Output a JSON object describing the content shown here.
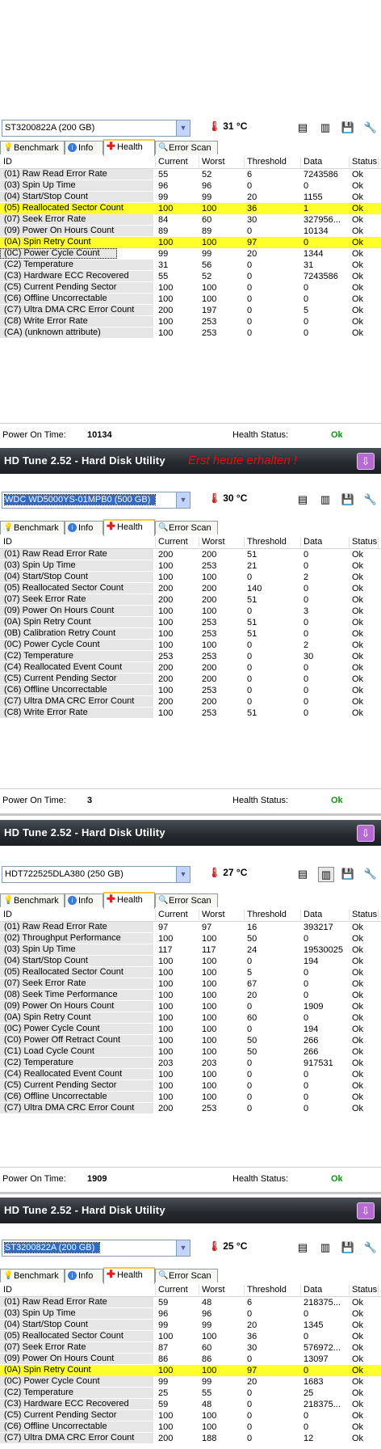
{
  "colors": {
    "highlight": "#ffff2a",
    "title_bg": "#262b31",
    "ok": "#0a9a0a",
    "note": "#e01010"
  },
  "tabs": [
    "Benchmark",
    "Info",
    "Health",
    "Error Scan"
  ],
  "columns": [
    "ID",
    "Current",
    "Worst",
    "Threshold",
    "Data",
    "Status"
  ],
  "labels": {
    "power_on": "Power On Time:",
    "health": "Health Status:"
  },
  "temp_icon": "thermometer-icon",
  "toolbar_icons": [
    "copy-icon",
    "copy-info-icon",
    "save-icon",
    "options-icon"
  ],
  "panels": [
    {
      "title": "",
      "note": "",
      "drive": "ST3200822A (200 GB)",
      "drive_selected": false,
      "temp": "31 °C",
      "power_on": "10134",
      "health": "Ok",
      "rows": [
        {
          "id": "(01) Raw Read Error Rate",
          "current": "55",
          "worst": "52",
          "threshold": "6",
          "data": "7243586",
          "status": "Ok"
        },
        {
          "id": "(03) Spin Up Time",
          "current": "96",
          "worst": "96",
          "threshold": "0",
          "data": "0",
          "status": "Ok"
        },
        {
          "id": "(04) Start/Stop Count",
          "current": "99",
          "worst": "99",
          "threshold": "20",
          "data": "1155",
          "status": "Ok"
        },
        {
          "id": "(05) Reallocated Sector Count",
          "current": "100",
          "worst": "100",
          "threshold": "36",
          "data": "1",
          "status": "Ok",
          "hl": true
        },
        {
          "id": "(07) Seek Error Rate",
          "current": "84",
          "worst": "60",
          "threshold": "30",
          "data": "327956...",
          "status": "Ok"
        },
        {
          "id": "(09) Power On Hours Count",
          "current": "89",
          "worst": "89",
          "threshold": "0",
          "data": "10134",
          "status": "Ok"
        },
        {
          "id": "(0A) Spin Retry Count",
          "current": "100",
          "worst": "100",
          "threshold": "97",
          "data": "0",
          "status": "Ok",
          "hl": true
        },
        {
          "id": "(0C) Power Cycle Count",
          "current": "99",
          "worst": "99",
          "threshold": "20",
          "data": "1344",
          "status": "Ok",
          "focus": true
        },
        {
          "id": "(C2) Temperature",
          "current": "31",
          "worst": "56",
          "threshold": "0",
          "data": "31",
          "status": "Ok"
        },
        {
          "id": "(C3) Hardware ECC Recovered",
          "current": "55",
          "worst": "52",
          "threshold": "0",
          "data": "7243586",
          "status": "Ok"
        },
        {
          "id": "(C5) Current Pending Sector",
          "current": "100",
          "worst": "100",
          "threshold": "0",
          "data": "0",
          "status": "Ok"
        },
        {
          "id": "(C6) Offline Uncorrectable",
          "current": "100",
          "worst": "100",
          "threshold": "0",
          "data": "0",
          "status": "Ok"
        },
        {
          "id": "(C7) Ultra DMA CRC Error Count",
          "current": "200",
          "worst": "197",
          "threshold": "0",
          "data": "5",
          "status": "Ok"
        },
        {
          "id": "(C8) Write Error Rate",
          "current": "100",
          "worst": "253",
          "threshold": "0",
          "data": "0",
          "status": "Ok"
        },
        {
          "id": "(CA) (unknown attribute)",
          "current": "100",
          "worst": "253",
          "threshold": "0",
          "data": "0",
          "status": "Ok"
        }
      ]
    },
    {
      "title": "HD Tune 2.52 - Hard Disk Utility",
      "note": "Erst heute erhalten !",
      "drive": "WDC WD5000YS-01MPB0 (500 GB)",
      "drive_selected": true,
      "temp": "30 °C",
      "power_on": "3",
      "health": "Ok",
      "rows": [
        {
          "id": "(01) Raw Read Error Rate",
          "current": "200",
          "worst": "200",
          "threshold": "51",
          "data": "0",
          "status": "Ok"
        },
        {
          "id": "(03) Spin Up Time",
          "current": "100",
          "worst": "253",
          "threshold": "21",
          "data": "0",
          "status": "Ok"
        },
        {
          "id": "(04) Start/Stop Count",
          "current": "100",
          "worst": "100",
          "threshold": "0",
          "data": "2",
          "status": "Ok"
        },
        {
          "id": "(05) Reallocated Sector Count",
          "current": "200",
          "worst": "200",
          "threshold": "140",
          "data": "0",
          "status": "Ok"
        },
        {
          "id": "(07) Seek Error Rate",
          "current": "200",
          "worst": "200",
          "threshold": "51",
          "data": "0",
          "status": "Ok"
        },
        {
          "id": "(09) Power On Hours Count",
          "current": "100",
          "worst": "100",
          "threshold": "0",
          "data": "3",
          "status": "Ok"
        },
        {
          "id": "(0A) Spin Retry Count",
          "current": "100",
          "worst": "253",
          "threshold": "51",
          "data": "0",
          "status": "Ok"
        },
        {
          "id": "(0B) Calibration Retry Count",
          "current": "100",
          "worst": "253",
          "threshold": "51",
          "data": "0",
          "status": "Ok"
        },
        {
          "id": "(0C) Power Cycle Count",
          "current": "100",
          "worst": "100",
          "threshold": "0",
          "data": "2",
          "status": "Ok"
        },
        {
          "id": "(C2) Temperature",
          "current": "253",
          "worst": "253",
          "threshold": "0",
          "data": "30",
          "status": "Ok"
        },
        {
          "id": "(C4) Reallocated Event Count",
          "current": "200",
          "worst": "200",
          "threshold": "0",
          "data": "0",
          "status": "Ok"
        },
        {
          "id": "(C5) Current Pending Sector",
          "current": "200",
          "worst": "200",
          "threshold": "0",
          "data": "0",
          "status": "Ok"
        },
        {
          "id": "(C6) Offline Uncorrectable",
          "current": "100",
          "worst": "253",
          "threshold": "0",
          "data": "0",
          "status": "Ok"
        },
        {
          "id": "(C7) Ultra DMA CRC Error Count",
          "current": "200",
          "worst": "200",
          "threshold": "0",
          "data": "0",
          "status": "Ok"
        },
        {
          "id": "(C8) Write Error Rate",
          "current": "100",
          "worst": "253",
          "threshold": "51",
          "data": "0",
          "status": "Ok"
        }
      ]
    },
    {
      "title": "HD Tune 2.52 - Hard Disk Utility",
      "note": "",
      "drive": "HDT722525DLA380 (250 GB)",
      "drive_selected": false,
      "temp": "27 °C",
      "power_on": "1909",
      "health": "Ok",
      "rows": [
        {
          "id": "(01) Raw Read Error Rate",
          "current": "97",
          "worst": "97",
          "threshold": "16",
          "data": "393217",
          "status": "Ok"
        },
        {
          "id": "(02) Throughput Performance",
          "current": "100",
          "worst": "100",
          "threshold": "50",
          "data": "0",
          "status": "Ok"
        },
        {
          "id": "(03) Spin Up Time",
          "current": "117",
          "worst": "117",
          "threshold": "24",
          "data": "19530025",
          "status": "Ok"
        },
        {
          "id": "(04) Start/Stop Count",
          "current": "100",
          "worst": "100",
          "threshold": "0",
          "data": "194",
          "status": "Ok"
        },
        {
          "id": "(05) Reallocated Sector Count",
          "current": "100",
          "worst": "100",
          "threshold": "5",
          "data": "0",
          "status": "Ok"
        },
        {
          "id": "(07) Seek Error Rate",
          "current": "100",
          "worst": "100",
          "threshold": "67",
          "data": "0",
          "status": "Ok"
        },
        {
          "id": "(08) Seek Time Performance",
          "current": "100",
          "worst": "100",
          "threshold": "20",
          "data": "0",
          "status": "Ok"
        },
        {
          "id": "(09) Power On Hours Count",
          "current": "100",
          "worst": "100",
          "threshold": "0",
          "data": "1909",
          "status": "Ok"
        },
        {
          "id": "(0A) Spin Retry Count",
          "current": "100",
          "worst": "100",
          "threshold": "60",
          "data": "0",
          "status": "Ok"
        },
        {
          "id": "(0C) Power Cycle Count",
          "current": "100",
          "worst": "100",
          "threshold": "0",
          "data": "194",
          "status": "Ok"
        },
        {
          "id": "(C0) Power Off Retract Count",
          "current": "100",
          "worst": "100",
          "threshold": "50",
          "data": "266",
          "status": "Ok"
        },
        {
          "id": "(C1) Load Cycle Count",
          "current": "100",
          "worst": "100",
          "threshold": "50",
          "data": "266",
          "status": "Ok"
        },
        {
          "id": "(C2) Temperature",
          "current": "203",
          "worst": "203",
          "threshold": "0",
          "data": "917531",
          "status": "Ok"
        },
        {
          "id": "(C4) Reallocated Event Count",
          "current": "100",
          "worst": "100",
          "threshold": "0",
          "data": "0",
          "status": "Ok"
        },
        {
          "id": "(C5) Current Pending Sector",
          "current": "100",
          "worst": "100",
          "threshold": "0",
          "data": "0",
          "status": "Ok"
        },
        {
          "id": "(C6) Offline Uncorrectable",
          "current": "100",
          "worst": "100",
          "threshold": "0",
          "data": "0",
          "status": "Ok"
        },
        {
          "id": "(C7) Ultra DMA CRC Error Count",
          "current": "200",
          "worst": "253",
          "threshold": "0",
          "data": "0",
          "status": "Ok"
        }
      ]
    },
    {
      "title": "HD Tune 2.52 - Hard Disk Utility",
      "note": "",
      "drive": "ST3200822A (200 GB)",
      "drive_selected": true,
      "temp": "25 °C",
      "power_on": "",
      "health": "",
      "rows": [
        {
          "id": "(01) Raw Read Error Rate",
          "current": "59",
          "worst": "48",
          "threshold": "6",
          "data": "218375...",
          "status": "Ok"
        },
        {
          "id": "(03) Spin Up Time",
          "current": "96",
          "worst": "96",
          "threshold": "0",
          "data": "0",
          "status": "Ok"
        },
        {
          "id": "(04) Start/Stop Count",
          "current": "99",
          "worst": "99",
          "threshold": "20",
          "data": "1345",
          "status": "Ok"
        },
        {
          "id": "(05) Reallocated Sector Count",
          "current": "100",
          "worst": "100",
          "threshold": "36",
          "data": "0",
          "status": "Ok"
        },
        {
          "id": "(07) Seek Error Rate",
          "current": "87",
          "worst": "60",
          "threshold": "30",
          "data": "576972...",
          "status": "Ok"
        },
        {
          "id": "(09) Power On Hours Count",
          "current": "86",
          "worst": "86",
          "threshold": "0",
          "data": "13097",
          "status": "Ok"
        },
        {
          "id": "(0A) Spin Retry Count",
          "current": "100",
          "worst": "100",
          "threshold": "97",
          "data": "0",
          "status": "Ok",
          "hl": true
        },
        {
          "id": "(0C) Power Cycle Count",
          "current": "99",
          "worst": "99",
          "threshold": "20",
          "data": "1683",
          "status": "Ok"
        },
        {
          "id": "(C2) Temperature",
          "current": "25",
          "worst": "55",
          "threshold": "0",
          "data": "25",
          "status": "Ok"
        },
        {
          "id": "(C3) Hardware ECC Recovered",
          "current": "59",
          "worst": "48",
          "threshold": "0",
          "data": "218375...",
          "status": "Ok"
        },
        {
          "id": "(C5) Current Pending Sector",
          "current": "100",
          "worst": "100",
          "threshold": "0",
          "data": "0",
          "status": "Ok"
        },
        {
          "id": "(C6) Offline Uncorrectable",
          "current": "100",
          "worst": "100",
          "threshold": "0",
          "data": "0",
          "status": "Ok"
        },
        {
          "id": "(C7) Ultra DMA CRC Error Count",
          "current": "200",
          "worst": "188",
          "threshold": "0",
          "data": "12",
          "status": "Ok"
        }
      ]
    }
  ]
}
